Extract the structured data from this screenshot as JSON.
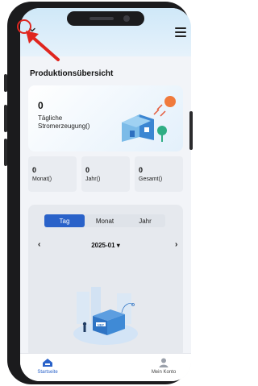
{
  "page": {
    "title": "Produktionsübersicht"
  },
  "hero": {
    "value": "0",
    "label": "Tägliche Stromerzeugung()"
  },
  "stats": [
    {
      "value": "0",
      "label": "Monat()"
    },
    {
      "value": "0",
      "label": "Jahr()"
    },
    {
      "value": "0",
      "label": "Gesamt()"
    }
  ],
  "chart": {
    "tabs": [
      "Tag",
      "Monat",
      "Jahr"
    ],
    "active_tab": "Tag",
    "period": "2025-01 ▾",
    "prev_label": "‹",
    "next_label": "›"
  },
  "illustration": {
    "logo_text": "NEP"
  },
  "nav": {
    "items": [
      {
        "label": "Startseite",
        "icon": "home-icon",
        "active": true
      },
      {
        "label": "Mein Konto",
        "icon": "person-icon",
        "active": false
      }
    ]
  },
  "colors": {
    "accent": "#2a62c9",
    "annotation": "#e0261f",
    "header_bg": "#cfe8f8"
  }
}
